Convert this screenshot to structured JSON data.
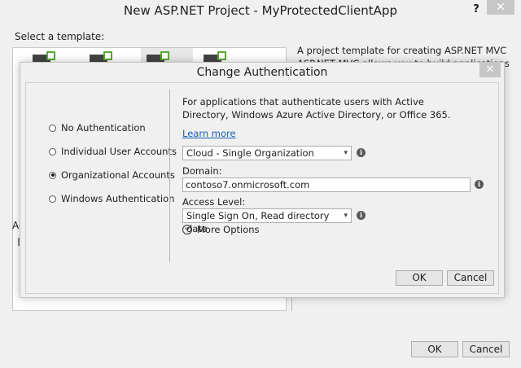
{
  "window": {
    "title": "New ASP.NET Project - MyProtectedClientApp",
    "help_label": "?",
    "close_label": "✕"
  },
  "left": {
    "select_template_label": "Select a template:",
    "partial_label": "Ac"
  },
  "right": {
    "description_line1": "A project template for creating ASP.NET MVC applications.",
    "description_line2": "ASP.NET MVC allows you to build applications using the"
  },
  "dialog": {
    "title": "Change Authentication",
    "close_label": "✕",
    "options": [
      {
        "label": "No Authentication",
        "selected": false
      },
      {
        "label": "Individual User Accounts",
        "selected": false
      },
      {
        "label": "Organizational Accounts",
        "selected": true
      },
      {
        "label": "Windows Authentication",
        "selected": false
      }
    ],
    "info_text": "For applications that authenticate users with Active Directory, Windows Azure Active Directory, or Office 365.",
    "learn_more": "Learn more",
    "auth_type_value": "Cloud - Single Organization",
    "domain_label": "Domain:",
    "domain_value": "contoso7.onmicrosoft.com",
    "access_level_label": "Access Level:",
    "access_level_value": "Single Sign On, Read directory data",
    "more_options": "More Options",
    "ok_label": "OK",
    "cancel_label": "Cancel"
  },
  "footer": {
    "ok_label": "OK",
    "cancel_label": "Cancel"
  },
  "icons": {
    "info": "i",
    "dropdown": "▾"
  }
}
